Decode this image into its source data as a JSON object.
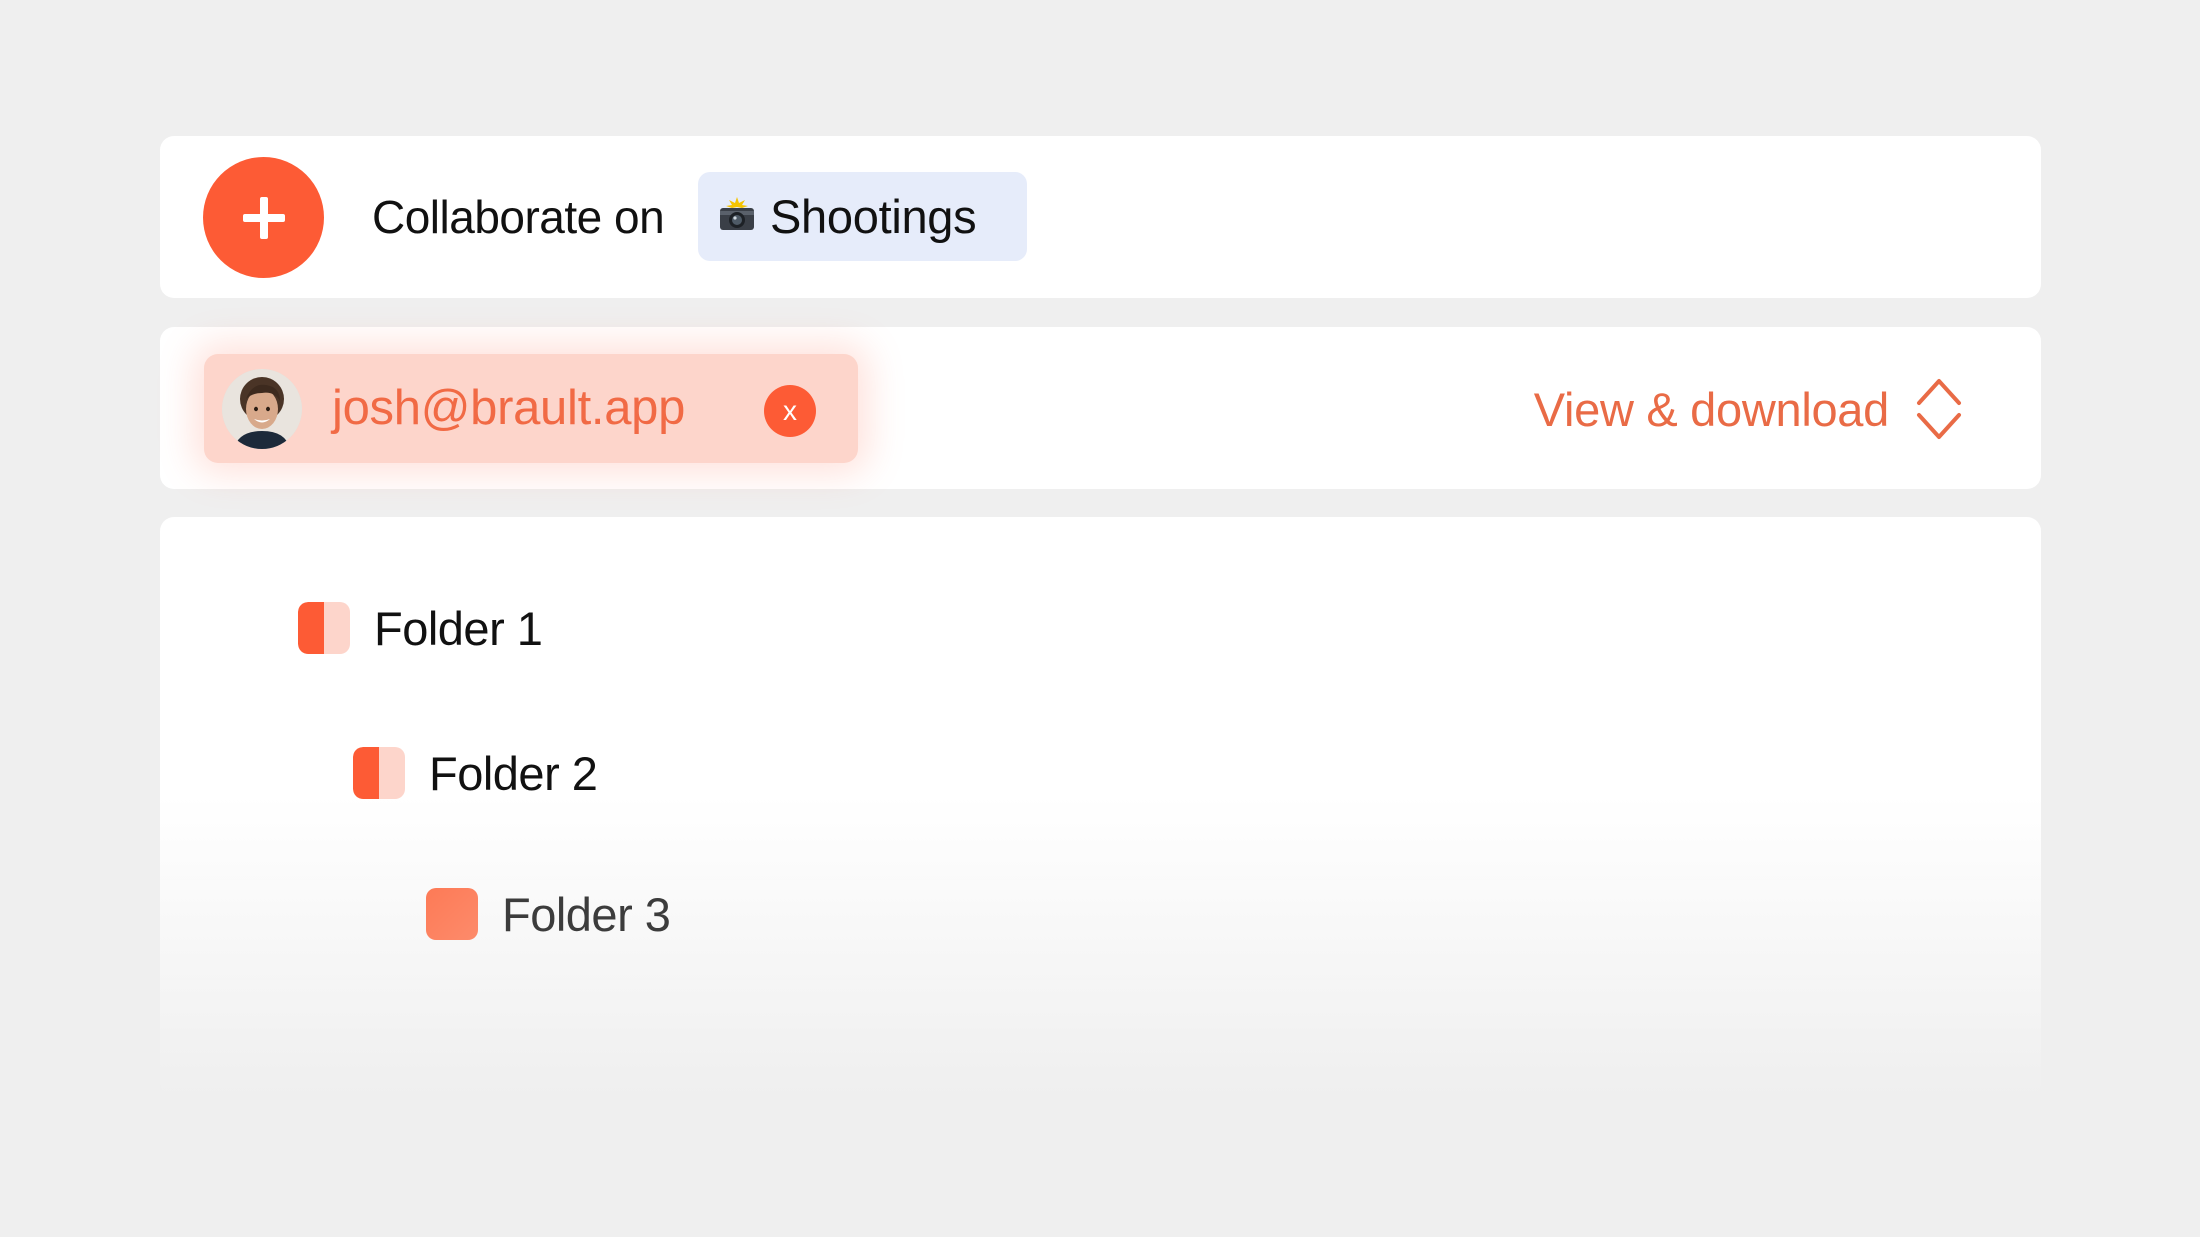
{
  "collaborate": {
    "add_icon": "plus-icon",
    "label": "Collaborate on",
    "project": {
      "emoji_icon": "camera-flash-icon",
      "name": "Shootings"
    }
  },
  "share": {
    "user": {
      "avatar": "user-avatar-photo",
      "email": "josh@brault.app",
      "remove_label": "x"
    },
    "permission": {
      "label": "View & download",
      "icon": "chevron-up-down-icon"
    }
  },
  "folders": [
    {
      "name": "Folder 1",
      "icon": "folder-half-icon"
    },
    {
      "name": "Folder 2",
      "icon": "folder-half-icon"
    },
    {
      "name": "Folder 3",
      "icon": "folder-solid-icon"
    }
  ],
  "colors": {
    "accent": "#fd5b35",
    "accent_light": "#fdd5cb",
    "chip_blue": "#e6ecfa",
    "background": "#efefef"
  }
}
